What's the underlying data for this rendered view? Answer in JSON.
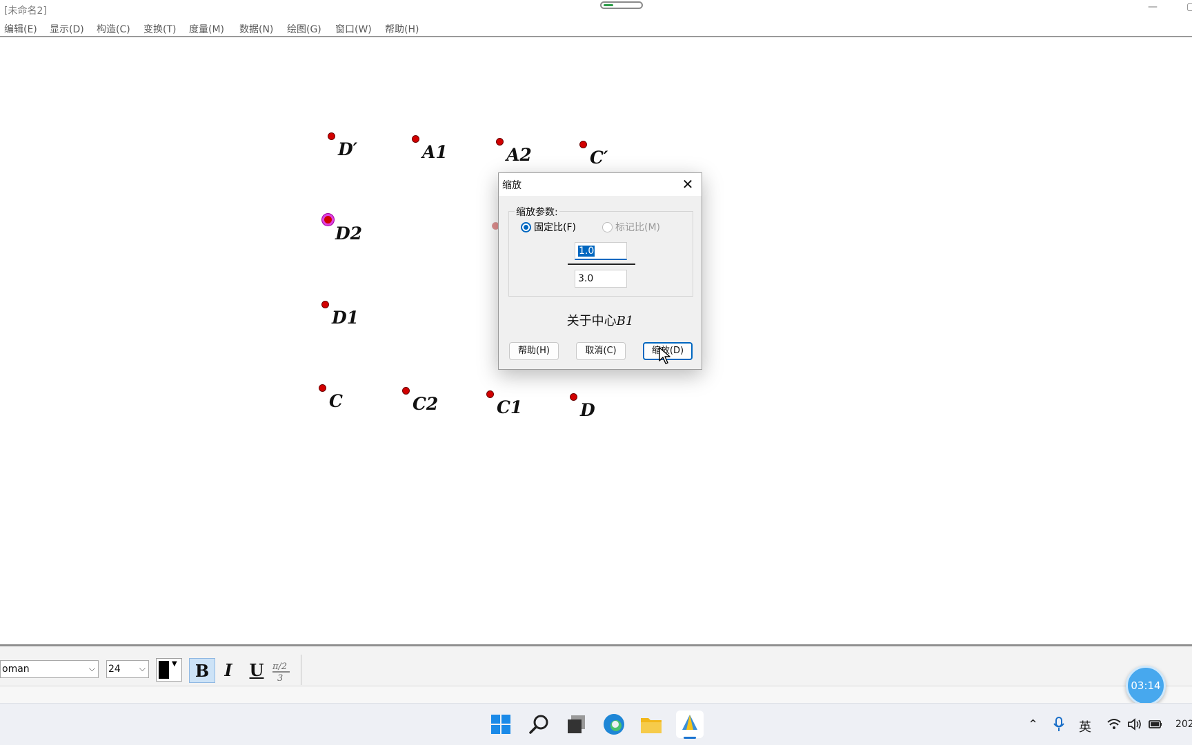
{
  "window": {
    "title": "[未命名2]"
  },
  "menu": [
    "编辑(E)",
    "显示(D)",
    "构造(C)",
    "变换(T)",
    "度量(M)",
    "数据(N)",
    "绘图(G)",
    "窗口(W)",
    "帮助(H)"
  ],
  "canvas": {
    "points": {
      "d_prime": "D′",
      "a1": "A1",
      "a2": "A2",
      "c_prime": "C′",
      "d2": "D2",
      "d1": "D1",
      "c": "C",
      "c2": "C2",
      "c1": "C1",
      "d": "D"
    }
  },
  "dialog": {
    "title": "缩放",
    "group_label": "缩放参数:",
    "radio_fixed": "固定比(F)",
    "radio_marked": "标记比(M)",
    "numerator": "1.0",
    "denominator": "3.0",
    "center_prefix": "关于中心",
    "center_point": "B1",
    "help_button": "帮助(H)",
    "cancel_button": "取消(C)",
    "dilate_button": "缩放(D)"
  },
  "text_toolbar": {
    "font_name": "oman",
    "font_size": "24",
    "bold": "B",
    "italic": "I",
    "underline": "U",
    "colors": {
      "text_color": "#000000",
      "active_button": "#cde3f7"
    }
  },
  "timer": "03:14",
  "tray": {
    "language": "英",
    "clock_partial": "202"
  },
  "icons": [
    "windows-start-icon",
    "search-icon",
    "task-view-icon",
    "edge-browser-icon",
    "file-explorer-icon",
    "geometry-app-icon",
    "chevron-up-icon",
    "microphone-icon",
    "wifi-icon",
    "volume-icon",
    "battery-icon"
  ]
}
